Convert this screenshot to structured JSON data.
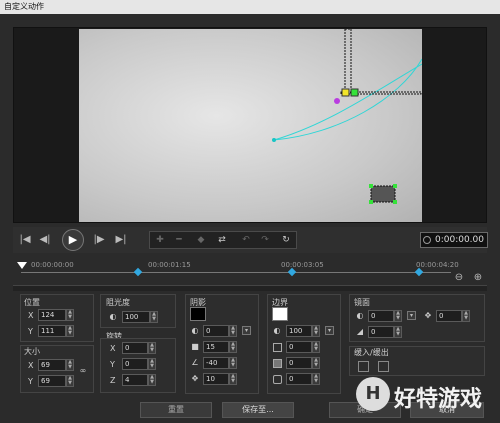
{
  "window": {
    "title": "自定义动作"
  },
  "transport": {
    "icons": [
      "skip-start",
      "step-back",
      "play",
      "step-forward",
      "skip-end"
    ],
    "timecode": "0:00:00.00"
  },
  "timeline": {
    "labels": [
      "00:00:00:00",
      "00:00:01:15",
      "00:00:03:05",
      "00:00:04:20"
    ]
  },
  "position": {
    "title": "位置",
    "x_label": "X",
    "x": "124",
    "y_label": "Y",
    "y": "111"
  },
  "size": {
    "title": "大小",
    "x_label": "X",
    "x": "69",
    "y_label": "Y",
    "y": "69"
  },
  "opacity": {
    "title": "阻光度",
    "value": "100"
  },
  "rotation": {
    "title": "旋转",
    "x_label": "X",
    "x": "0",
    "y_label": "Y",
    "y": "0",
    "z_label": "Z",
    "z": "4"
  },
  "shadow": {
    "title": "阴影",
    "color": "#000000",
    "v1": "0",
    "v2": "15",
    "v3": "-40",
    "v4": "10"
  },
  "border": {
    "title": "边界",
    "color": "#ffffff",
    "v1": "100",
    "v2": "0",
    "v3": "0",
    "v4": "0"
  },
  "mirror": {
    "title": "镜面",
    "v1": "0",
    "v2": "0",
    "v3": "0"
  },
  "fade": {
    "title": "缓入/缓出"
  },
  "buttons": {
    "reset": "重置",
    "save_to": "保存至...",
    "ok": "确定",
    "cancel": "取消"
  },
  "watermark": {
    "logo": "H",
    "text": "好特游戏"
  }
}
